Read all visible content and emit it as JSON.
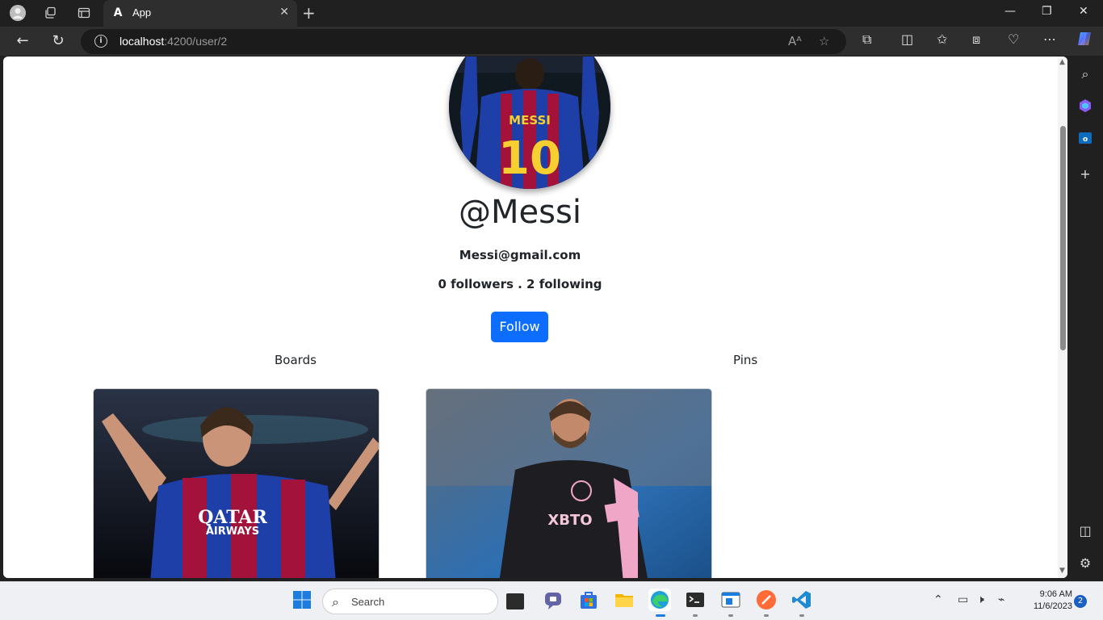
{
  "browser": {
    "tab_title": "App",
    "tab_favicon": "A",
    "url_host": "localhost",
    "url_path": ":4200/user/2"
  },
  "profile": {
    "username": "@Messi",
    "email": "Messi@gmail.com",
    "followers_text": "0 followers",
    "separator": " . ",
    "following_text": "2 following",
    "follow_button": "Follow",
    "avatar_jersey_name": "MESSI",
    "avatar_jersey_number": "10"
  },
  "tabs": {
    "boards": "Boards",
    "pins": "Pins"
  },
  "cards": [
    {
      "jersey_text_1": "QATAR",
      "jersey_text_2": "AIRWAYS"
    },
    {
      "jersey_text": "XBTO"
    }
  ],
  "taskbar": {
    "search_label": "Search",
    "time": "9:06 AM",
    "date": "11/6/2023",
    "notification_count": "2"
  },
  "colors": {
    "accent": "#0d6efd",
    "chrome_bg": "#202020",
    "toolbar_bg": "#2e2e2e"
  }
}
